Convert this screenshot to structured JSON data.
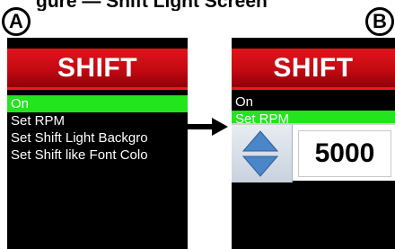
{
  "figure_caption": "gure — Shift Light Screen",
  "panels": [
    {
      "badge": "A",
      "title": "SHIFT",
      "menu": [
        "On",
        "Set RPM",
        "Set Shift Light Backgro",
        "Set Shift like Font Colo"
      ],
      "selected_index": 0
    },
    {
      "badge": "B",
      "title": "SHIFT",
      "menu": [
        "On",
        "Set RPM"
      ],
      "selected_index": 1,
      "popup": {
        "value": "5000",
        "up_icon": "arrow-up-icon",
        "down_icon": "arrow-down-icon"
      }
    }
  ],
  "colors": {
    "header_red": "#c40a12",
    "selection_green": "#22e51e",
    "spinner_blue": "#4a86c8"
  }
}
